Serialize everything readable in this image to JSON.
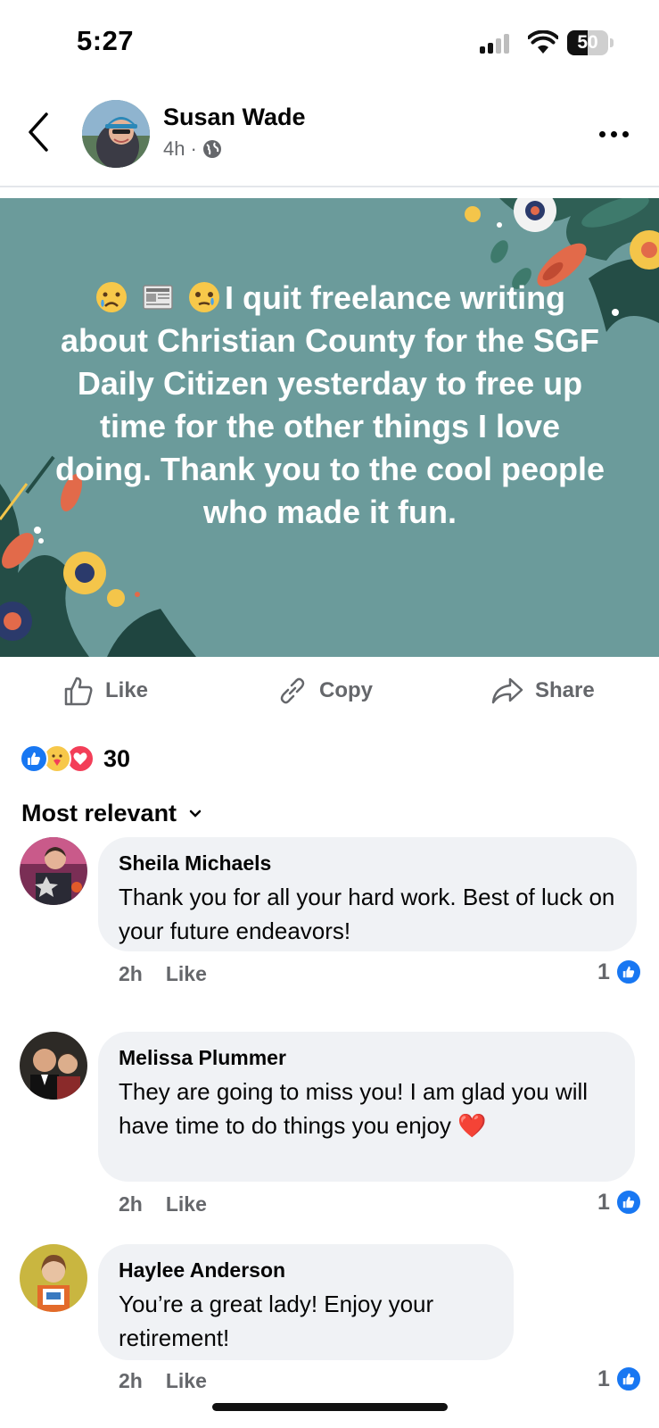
{
  "status_bar": {
    "time": "5:27",
    "battery": "50",
    "battery_level": 0.5
  },
  "post": {
    "author": "Susan Wade",
    "time": "4h",
    "separator": "·",
    "text": "I quit freelance writing about Christian County for the SGF Daily Citizen yesterday to free up time for the other things I love doing. Thank you to the cool people who made it fun.",
    "background_color": "#6b9b9b"
  },
  "actions": {
    "like": "Like",
    "copy": "Copy",
    "share": "Share"
  },
  "reactions": {
    "count": "30",
    "icons": [
      "like-reaction-icon",
      "care-reaction-icon",
      "love-reaction-icon"
    ]
  },
  "sort": {
    "label": "Most relevant"
  },
  "comments": [
    {
      "name": "Sheila Michaels",
      "text": "Thank you for all your hard work. Best of luck on your future endeavors!",
      "time": "2h",
      "like_label": "Like",
      "likes": "1"
    },
    {
      "name": "Melissa Plummer",
      "text": "They are going to miss you! I am glad you will have time to do things you enjoy ❤️",
      "time": "2h",
      "like_label": "Like",
      "likes": "1"
    },
    {
      "name": "Haylee Anderson",
      "text": "You’re a great lady! Enjoy your retirement!",
      "time": "2h",
      "like_label": "Like",
      "likes": "1"
    }
  ],
  "colors": {
    "accent": "#1877f2",
    "muted": "#65676b",
    "bubble": "#f0f2f5",
    "love": "#f33e58"
  }
}
